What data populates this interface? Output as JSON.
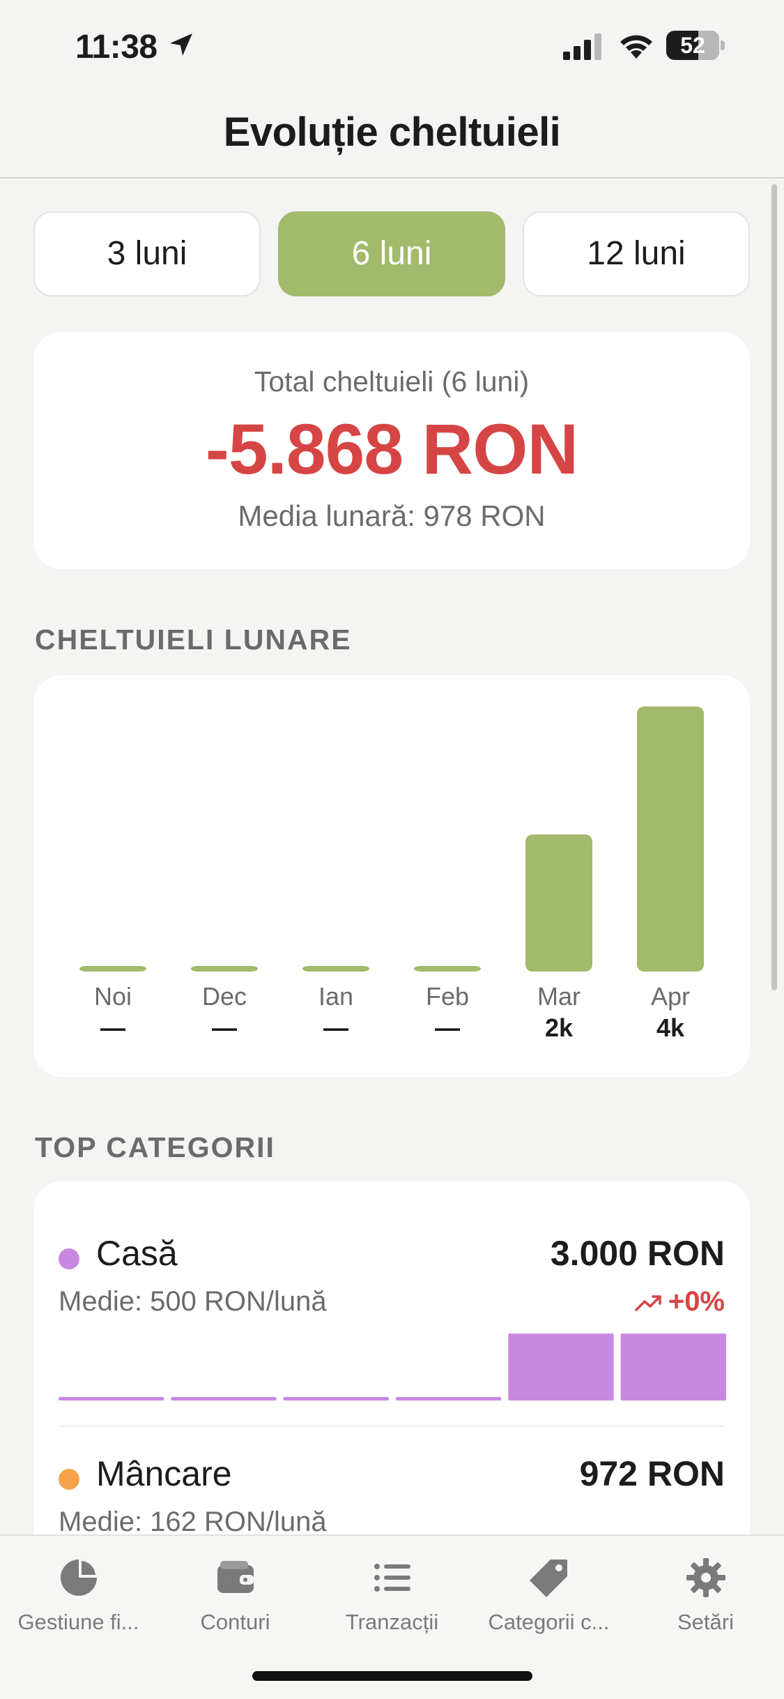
{
  "status_bar": {
    "time": "11:38",
    "battery": "52"
  },
  "header": {
    "title": "Evoluție cheltuieli"
  },
  "period_selector": {
    "options": [
      "3 luni",
      "6 luni",
      "12 luni"
    ],
    "selected": "6 luni"
  },
  "total": {
    "label": "Total cheltuieli (6 luni)",
    "value": "-5.868 RON",
    "monthly_average": "Media lunară: 978 RON"
  },
  "monthly_section": {
    "title": "CHELTUIELI LUNARE"
  },
  "chart_data": {
    "type": "bar",
    "categories": [
      "Noi",
      "Dec",
      "Ian",
      "Feb",
      "Mar",
      "Apr"
    ],
    "values": [
      0,
      0,
      0,
      0,
      2000,
      3868
    ],
    "value_labels": [
      "—",
      "—",
      "—",
      "—",
      "2k",
      "4k"
    ],
    "ylim": [
      0,
      3868
    ],
    "bar_color": "#a3b96b",
    "grid": false
  },
  "top_categories": {
    "title": "TOP CATEGORII",
    "items": [
      {
        "name": "Casă",
        "amount": "3.000 RON",
        "average": "Medie: 500 RON/lună",
        "trend": "+0%",
        "color": "#c888e0",
        "monthly_values": [
          0,
          0,
          0,
          0,
          1500,
          1500
        ]
      },
      {
        "name": "Mâncare",
        "amount": "972 RON",
        "average": "Medie: 162 RON/lună",
        "color": "#f5a24a"
      }
    ]
  },
  "tab_bar": {
    "tabs": [
      {
        "label": "Gestiune fi...",
        "icon": "pie-chart-icon"
      },
      {
        "label": "Conturi",
        "icon": "wallet-icon"
      },
      {
        "label": "Tranzacții",
        "icon": "list-icon"
      },
      {
        "label": "Categorii c...",
        "icon": "tag-icon"
      },
      {
        "label": "Setări",
        "icon": "gear-icon"
      }
    ]
  },
  "colors": {
    "accent": "#a3b96b",
    "negative": "#d64545",
    "background": "#f4f4f2"
  }
}
